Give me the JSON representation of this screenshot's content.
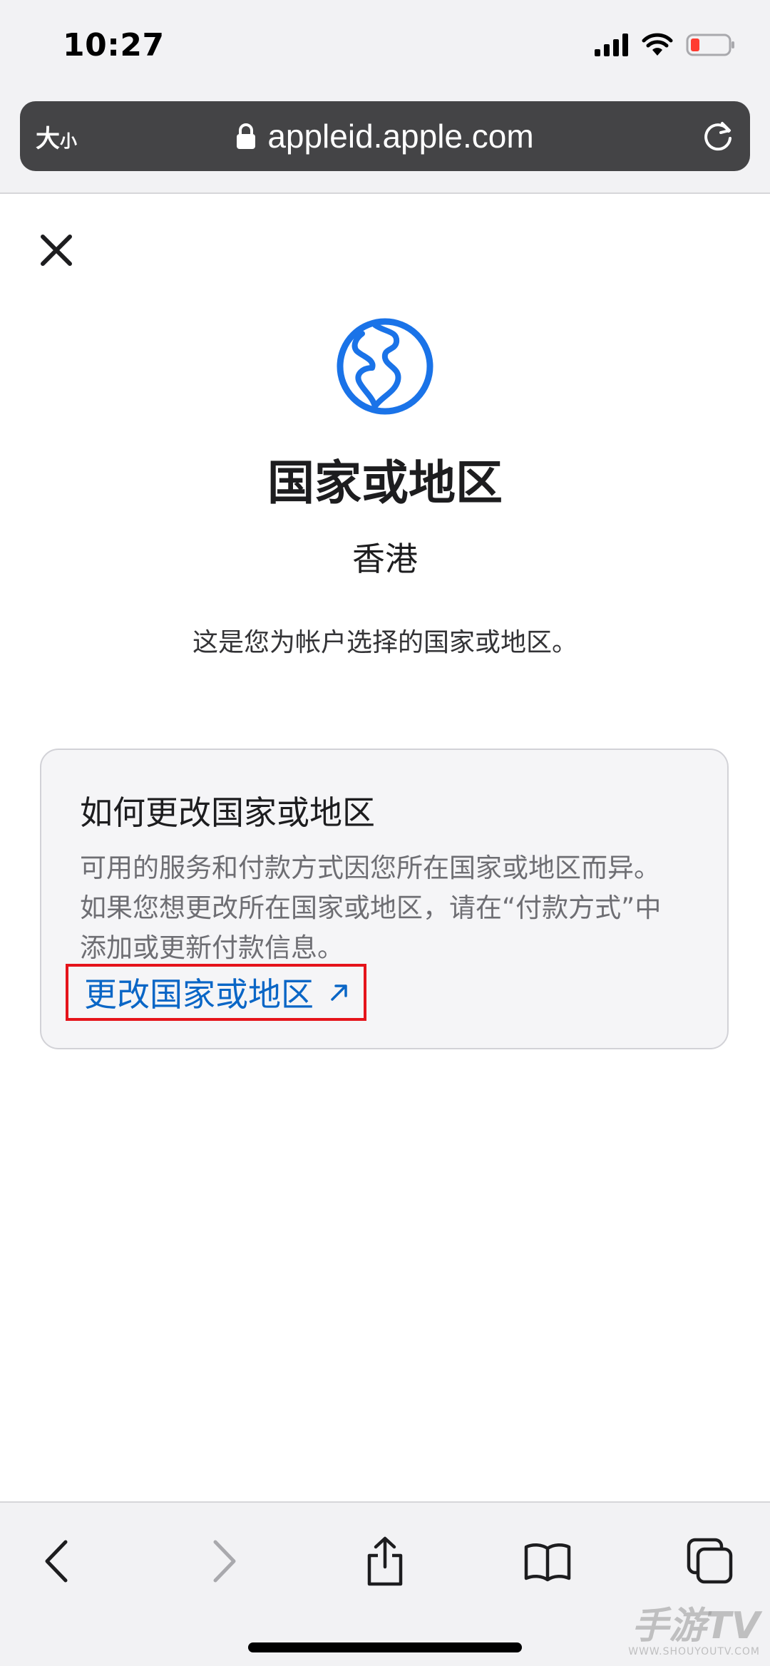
{
  "status_bar": {
    "time": "10:27",
    "icons": [
      "cellular-signal-icon",
      "wifi-icon",
      "battery-low-icon"
    ]
  },
  "address_bar": {
    "text_size_big": "大",
    "text_size_small": "小",
    "url": "appleid.apple.com",
    "icons": [
      "lock-icon",
      "reload-icon"
    ]
  },
  "content": {
    "title": "国家或地区",
    "region": "香港",
    "description": "这是您为帐户选择的国家或地区。"
  },
  "card": {
    "heading": "如何更改国家或地区",
    "body_lines": [
      "可用的服务和付款方式因您所在国家或地区而异。",
      "如果您想更改所在国家或地区，请在“付款方式”中",
      "添加或更新付款信息。"
    ],
    "link_label": "更改国家或地区"
  },
  "toolbar": {
    "icons": [
      "back-icon",
      "forward-icon",
      "share-icon",
      "bookmarks-icon",
      "tabs-icon"
    ]
  },
  "watermark": {
    "main": "手游TV",
    "sub": "WWW.SHOUYOUTV.COM"
  },
  "colors": {
    "accent_blue": "#0a66c6",
    "globe_blue": "#1a73e8",
    "highlight_red": "#e5141b",
    "battery_red": "#ff3b30"
  }
}
